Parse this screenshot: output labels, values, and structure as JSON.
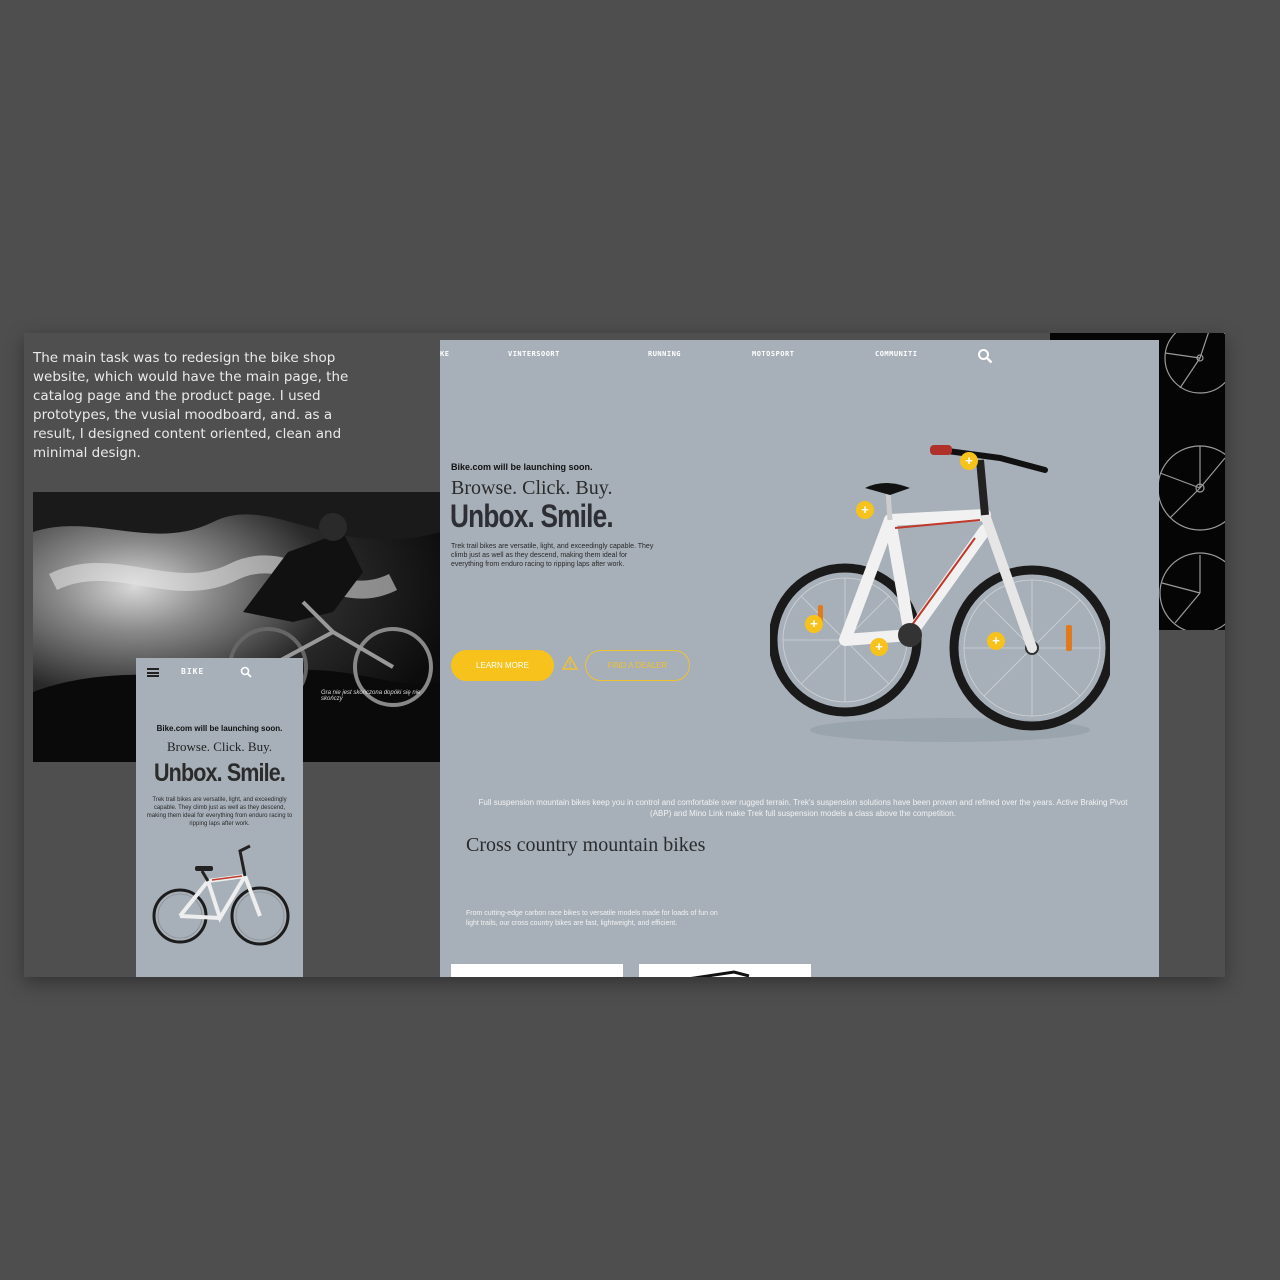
{
  "intro_text": "The main task was to redesign the bike shop website, which would have the main page, the catalog page and the product page. I used prototypes, the vusial moodboard, and. as a result, I designed content oriented, clean and minimal design.",
  "photo_caption": "Gra nie jest skończona dopóki się nie skończy",
  "mobile": {
    "brand": "BIKE",
    "launch": "Bike.com will be launching soon.",
    "tagline": "Browse. Click. Buy.",
    "headline": "Unbox. Smile.",
    "body": "Trek trail bikes are versatile, light, and exceedingly capable. They climb just as well as they descend, making them ideal for everything from enduro racing to ripping laps after work."
  },
  "desktop": {
    "nav": [
      "KE",
      "VINTERSOORT",
      "RUNNING",
      "MOTOSPORT",
      "COMMUNITI"
    ],
    "launch": "Bike.com will be launching soon.",
    "tagline": "Browse. Click. Buy.",
    "headline": "Unbox. Smile.",
    "intro": "Trek trail bikes are versatile, light, and exceedingly capable. They climb just as well as they descend, making them ideal for everything from enduro racing to ripping laps after work.",
    "btn_learn": "LEARN MORE",
    "btn_dealer": "FIND A DEALER",
    "hotspot_symbol": "+",
    "suspension_text": "Full suspension mountain bikes keep you in control and comfortable over rugged terrain. Trek's suspension solutions have been proven and refined over the years. Active Braking Pivot (ABP) and Mino Link make Trek full suspension models a class above the competition.",
    "cc_title": "Cross country mountain bikes",
    "cc_body": "From cutting-edge carbon race bikes to versatile models made for loads of fun on light trails, our cross country bikes are fast, lightweight, and efficient."
  },
  "colors": {
    "accent": "#f7c21b",
    "page_bg": "#a7b0b9",
    "frame_bg": "#4f4f4f",
    "backdrop": "#4e4e4e"
  },
  "icons": [
    "menu-icon",
    "search-icon",
    "warning-icon",
    "plus-icon"
  ]
}
